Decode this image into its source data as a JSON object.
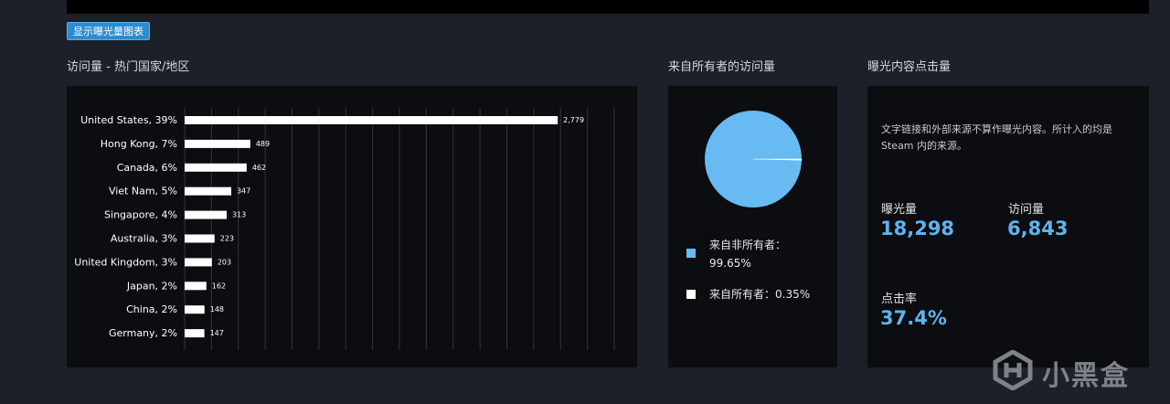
{
  "buttons": {
    "show_chart": "显示曝光量图表"
  },
  "sections": {
    "country_title": "访问量 - 热门国家/地区",
    "owner_title": "来自所有者的访问量",
    "clicks_title": "曝光内容点击量"
  },
  "chart_data": {
    "type": "bar",
    "orientation": "horizontal",
    "categories": [
      "United States, 39%",
      "Hong Kong, 7%",
      "Canada, 6%",
      "Viet Nam, 5%",
      "Singapore, 4%",
      "Australia, 3%",
      "United Kingdom, 3%",
      "Japan, 2%",
      "China, 2%",
      "Germany, 2%"
    ],
    "values": [
      2779,
      489,
      462,
      347,
      313,
      223,
      203,
      162,
      148,
      147
    ],
    "value_labels": [
      "2,779",
      "489",
      "462",
      "347",
      "313",
      "223",
      "203",
      "162",
      "148",
      "147"
    ],
    "xlim": [
      0,
      3200
    ],
    "grid": true,
    "bar_color": "#ffffff"
  },
  "pie": {
    "values": [
      99.65,
      0.35
    ],
    "colors": [
      "#67bbf2",
      "#ffffff"
    ],
    "legend": [
      {
        "label_line1": "来自非所有者：",
        "label_line2": "99.65%"
      },
      {
        "label_line1": "来自所有者：0.35%"
      }
    ]
  },
  "clicks": {
    "note": "文字链接和外部来源不算作曝光内容。所计入的均是 Steam 内的来源。",
    "impressions_label": "曝光量",
    "impressions_value": "18,298",
    "visits_label": "访问量",
    "visits_value": "6,843",
    "ctr_label": "点击率",
    "ctr_value": "37.4%"
  },
  "watermark": {
    "text": "小黑盒"
  },
  "colors": {
    "accent": "#5eb3ef",
    "background": "#1b2029",
    "panel": "#0b0d10"
  }
}
